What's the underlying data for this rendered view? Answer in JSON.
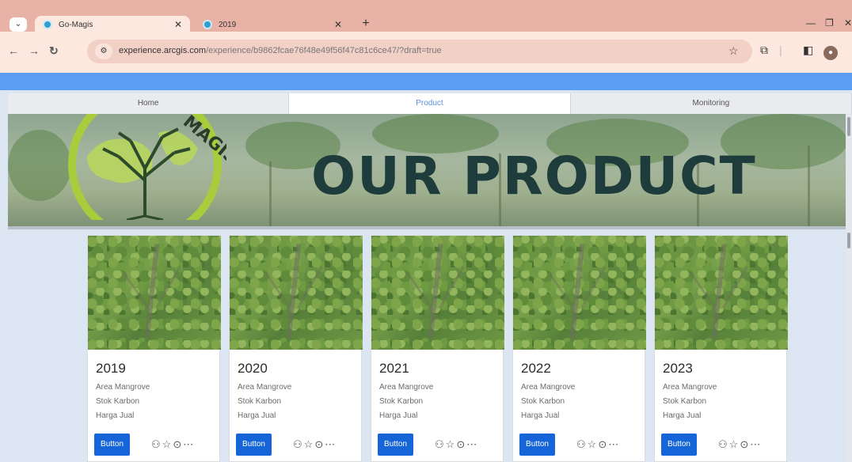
{
  "browser": {
    "tabs": [
      {
        "title": "Go-Magis",
        "active": true
      },
      {
        "title": "2019",
        "active": false
      }
    ],
    "new_tab_icon": "+",
    "address": {
      "domain": "experience.arcgis.com",
      "path": "/experience/b9862fcae76f48e49f56f47c81c6ce47/?draft=true"
    }
  },
  "nav": {
    "tabs": [
      "Home",
      "Product",
      "Monitoring"
    ],
    "active": "Product"
  },
  "hero": {
    "title": "OUR PRODUCT",
    "logo_text": "MAGIS"
  },
  "cards": [
    {
      "year": "2019",
      "lines": [
        "Area Mangrove",
        "Stok Karbon",
        "Harga Jual"
      ],
      "button": "Button"
    },
    {
      "year": "2020",
      "lines": [
        "Area Mangrove",
        "Stok Karbon",
        "Harga Jual"
      ],
      "button": "Button"
    },
    {
      "year": "2021",
      "lines": [
        "Area Mangrove",
        "Stok Karbon",
        "Harga Jual"
      ],
      "button": "Button"
    },
    {
      "year": "2022",
      "lines": [
        "Area Mangrove",
        "Stok Karbon",
        "Harga Jual"
      ],
      "button": "Button"
    },
    {
      "year": "2023",
      "lines": [
        "Area Mangrove",
        "Stok Karbon",
        "Harga Jual"
      ],
      "button": "Button"
    }
  ],
  "colors": {
    "titlebar": "#e8b3a6",
    "accent_blue": "#1565d8",
    "banner_strip": "#5b9cf4",
    "hero_title": "#1d3c3b"
  }
}
